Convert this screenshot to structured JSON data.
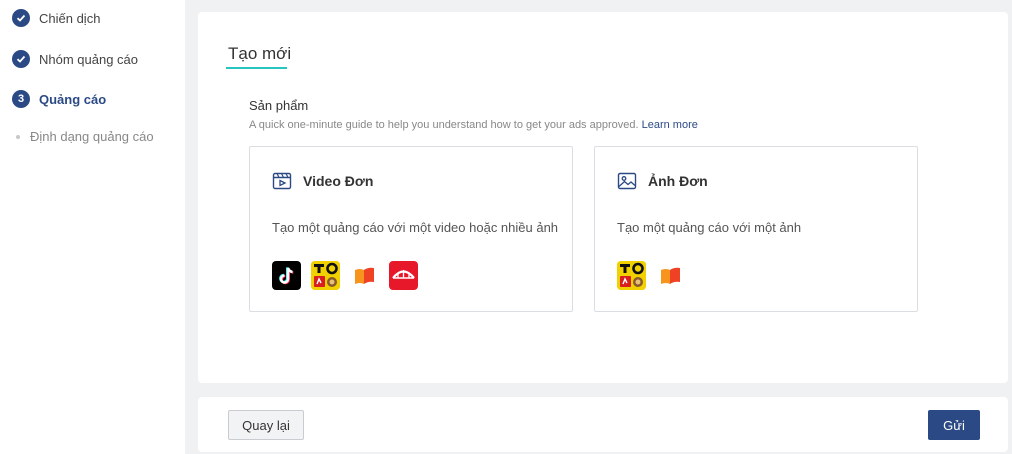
{
  "sidebar": {
    "steps": [
      {
        "label": "Chiến dịch",
        "state": "done",
        "badge": ""
      },
      {
        "label": "Nhóm quảng cáo",
        "state": "done",
        "badge": ""
      },
      {
        "label": "Quảng cáo",
        "state": "active",
        "badge": "3"
      }
    ],
    "substep": "Định dạng quảng cáo"
  },
  "main": {
    "title": "Tạo mới",
    "section_label": "Sản phẩm",
    "hint": "A quick one-minute guide to help you understand how to get your ads approved.",
    "learn_more": "Learn more",
    "options": [
      {
        "title": "Video Đơn",
        "desc": "Tạo một quảng cáo với một video hoặc nhiều ảnh",
        "icon": "video-icon",
        "apps": [
          "tiktok-icon",
          "topbuzz-icon",
          "babe-icon",
          "pangle-icon"
        ]
      },
      {
        "title": "Ảnh Đơn",
        "desc": "Tạo một quảng cáo với một ảnh",
        "icon": "image-icon",
        "apps": [
          "topbuzz-icon",
          "babe-icon"
        ]
      }
    ]
  },
  "footer": {
    "back_label": "Quay lại",
    "submit_label": "Gửi"
  },
  "colors": {
    "primary": "#2b4a85",
    "accent": "#28c5c0",
    "border": "#dadde1"
  }
}
